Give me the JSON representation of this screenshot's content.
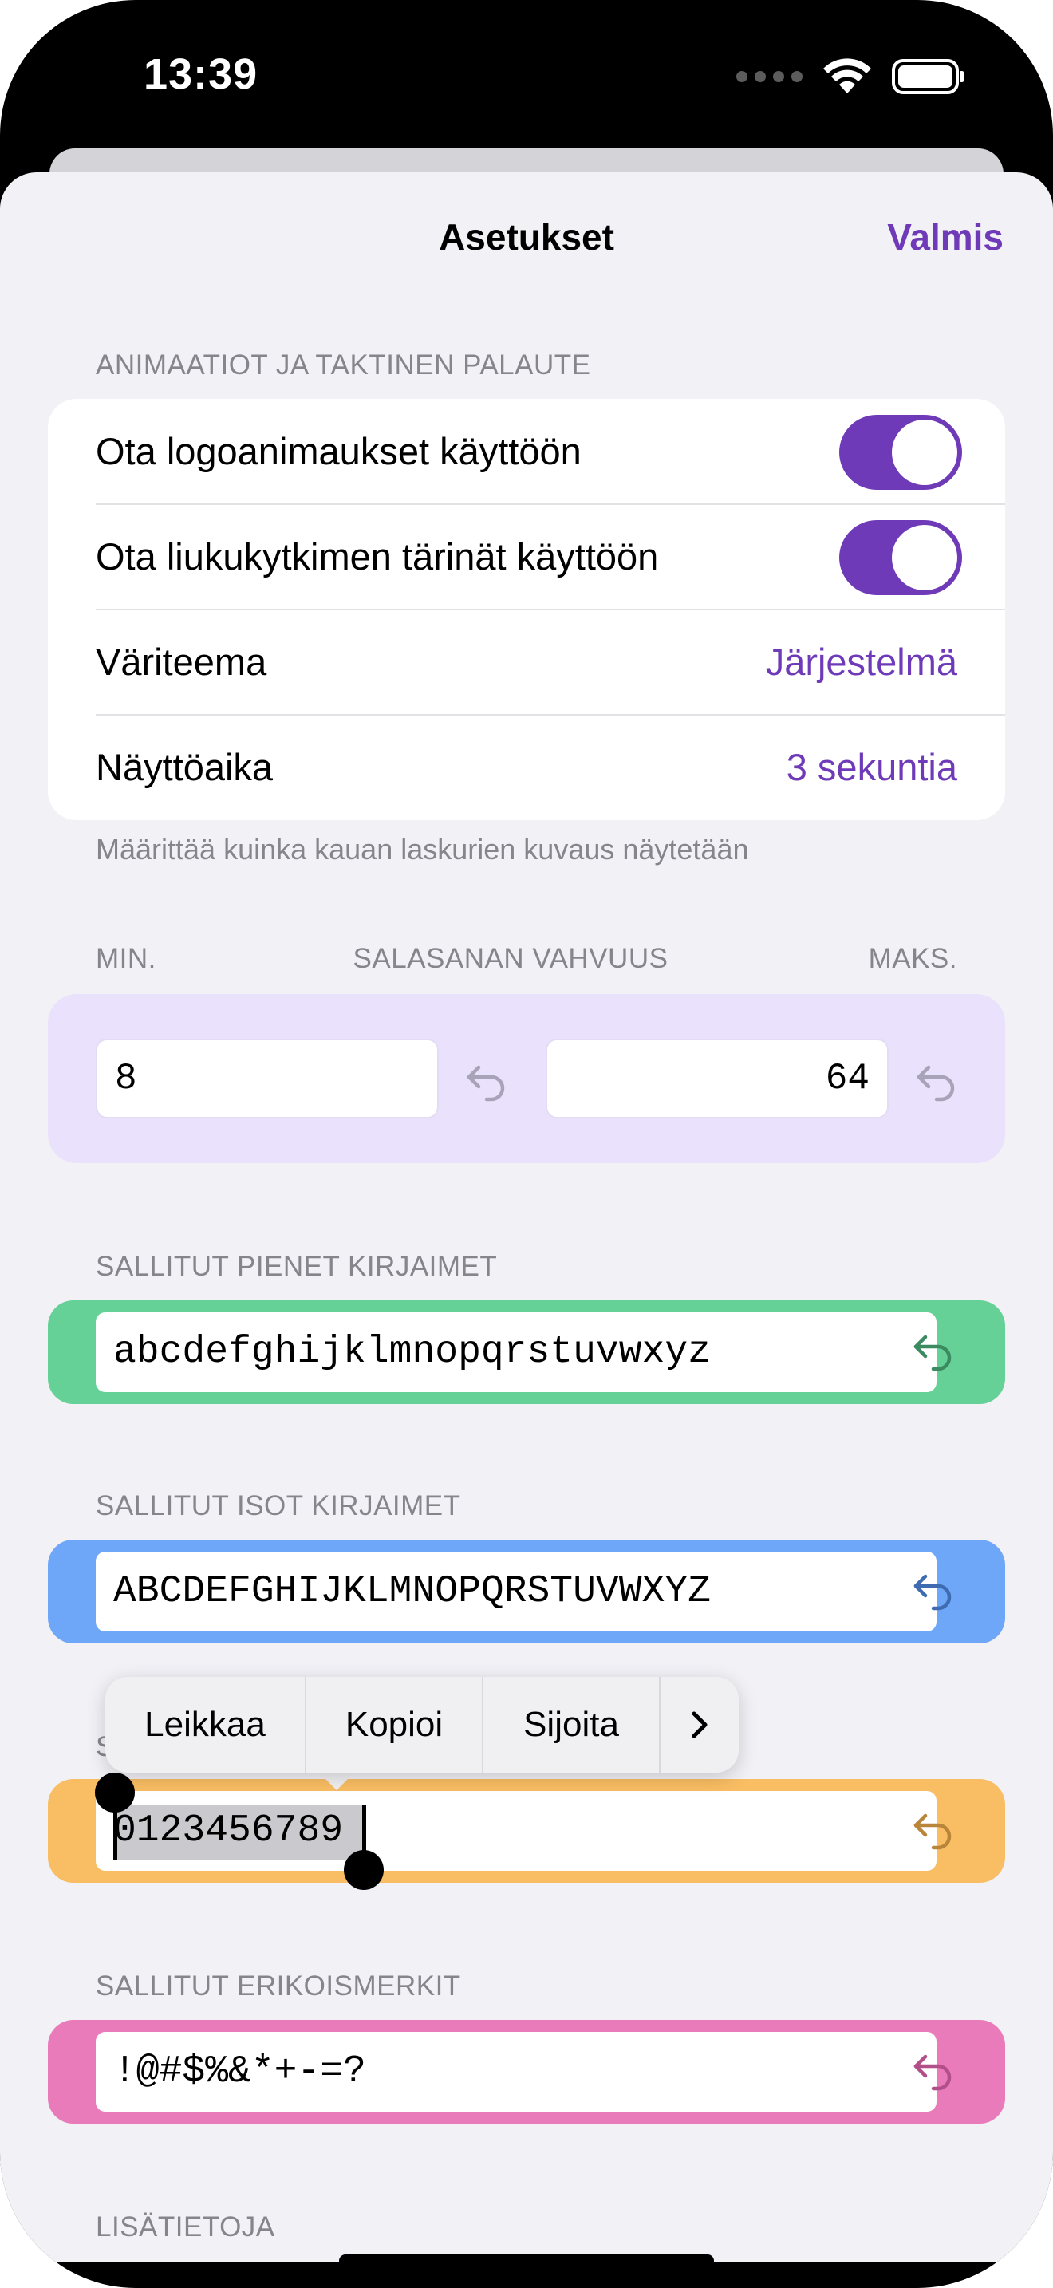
{
  "status_bar": {
    "time": "13:39",
    "icons": [
      "signal-dots-icon",
      "wifi-icon",
      "battery-icon"
    ]
  },
  "nav": {
    "title": "Asetukset",
    "done_label": "Valmis"
  },
  "colors": {
    "accent": "#6e3ab8",
    "strength_bg": "#eae2fc",
    "lowercase_bg": "#66d196",
    "uppercase_bg": "#6ea6f8",
    "digits_bg": "#f9bd63",
    "special_bg": "#e97bba"
  },
  "animations_section": {
    "header": "ANIMAATIOT JA TAKTINEN PALAUTE",
    "rows": [
      {
        "label": "Ota logoanimaukset käyttöön",
        "toggle_on": true
      },
      {
        "label": "Ota liukukytkimen tärinät käyttöön",
        "toggle_on": true
      },
      {
        "label": "Väriteema",
        "value": "Järjestelmä"
      },
      {
        "label": "Näyttöaika",
        "value": "3 sekuntia"
      }
    ],
    "footnote": "Määrittää kuinka kauan laskurien kuvaus näytetään"
  },
  "strength_section": {
    "min_label": "MIN.",
    "title": "SALASANAN VAHVUUS",
    "max_label": "MAKS.",
    "min_value": "8",
    "max_value": "64"
  },
  "lowercase_section": {
    "header": "SALLITUT PIENET KIRJAIMET",
    "value": "abcdefghijklmnopqrstuvwxyz"
  },
  "uppercase_section": {
    "header": "SALLITUT ISOT KIRJAIMET",
    "value": "ABCDEFGHIJKLMNOPQRSTUVWXYZ"
  },
  "digits_section": {
    "header_visible_char": "S",
    "value": "0123456789"
  },
  "special_section": {
    "header": "SALLITUT ERIKOISMERKIT",
    "value": "!@#$%&*+-=?"
  },
  "more_section": {
    "header": "LISÄTIETOJA"
  },
  "context_menu": {
    "items": [
      "Leikkaa",
      "Kopioi",
      "Sijoita"
    ],
    "more_icon": "chevron-right-icon"
  }
}
